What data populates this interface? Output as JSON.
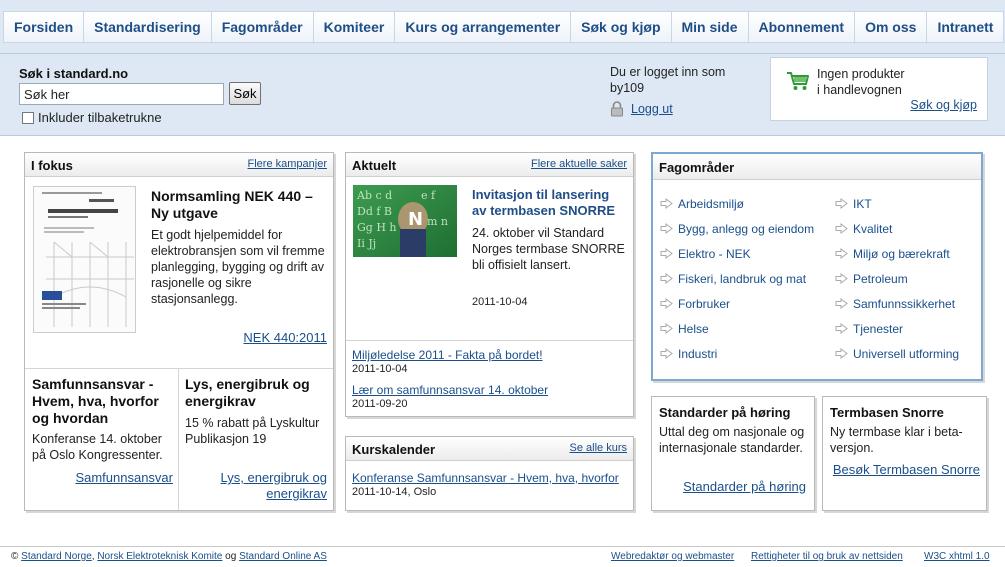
{
  "nav": {
    "items": [
      "Forsiden",
      "Standardisering",
      "Fagområder",
      "Komiteer",
      "Kurs og arrangementer",
      "Søk og kjøp",
      "Min side",
      "Abonnement",
      "Om oss",
      "Intranett"
    ]
  },
  "search": {
    "title": "Søk i standard.no",
    "value": "Søk her",
    "button": "Søk",
    "checkbox_label": "Inkluder tilbaketrukne"
  },
  "login": {
    "line1": "Du er logget inn som",
    "line2": "by109",
    "logout": "Logg ut"
  },
  "cart": {
    "line1": "Ingen produkter",
    "line2": "i handlevognen",
    "link": "Søk og kjøp"
  },
  "fokus": {
    "title": "I fokus",
    "more": "Flere kampanjer",
    "headline": "Normsamling NEK 440 – Ny utgave",
    "desc": "Et godt hjelpemiddel for elektrobransjen som vil fremme planlegging, bygging og drift av rasjonelle og sikre stasjonsanlegg.",
    "link": "NEK 440:2011",
    "sub1": {
      "title": "Samfunnsansvar - Hvem, hva, hvorfor og hvordan",
      "desc": "Konferanse 14. oktober på Oslo Kongressenter.",
      "link": "Samfunnsansvar"
    },
    "sub2": {
      "title": "Lys, energibruk og energikrav",
      "desc": "15 % rabatt på Lyskultur Publikasjon 19",
      "link": "Lys, energibruk og energikrav"
    }
  },
  "aktuelt": {
    "title": "Aktuelt",
    "more": "Flere aktuelle saker",
    "headline": "Invitasjon til lansering av termbasen SNORRE",
    "desc": "24. oktober vil Standard Norges termbase SNORRE bli offisielt lansert.",
    "date": "2011-10-04",
    "news": [
      {
        "title": "Miljøledelse 2011 - Fakta på bordet!",
        "date": "2011-10-04"
      },
      {
        "title": "Lær om samfunnsansvar 14. oktober",
        "date": "2011-09-20"
      }
    ]
  },
  "kurs": {
    "title": "Kurskalender",
    "more": "Se alle kurs",
    "item_title": "Konferanse Samfunnsansvar - Hvem, hva, hvorfor",
    "item_meta": "2011-10-14, Oslo"
  },
  "fag": {
    "title": "Fagområder",
    "col1": [
      "Arbeidsmiljø",
      "Bygg, anlegg og eiendom",
      "Elektro - NEK",
      "Fiskeri, landbruk og mat",
      "Forbruker",
      "Helse",
      "Industri"
    ],
    "col2": [
      "IKT",
      "Kvalitet",
      "Miljø og bærekraft",
      "Petroleum",
      "Samfunnssikkerhet",
      "Tjenester",
      "Universell utforming"
    ]
  },
  "horing": {
    "title": "Standarder på høring",
    "desc": "Uttal deg om nasjonale og internasjonale standarder.",
    "link": "Standarder på høring"
  },
  "termbase": {
    "title": "Termbasen Snorre",
    "desc": "Ny termbase klar i beta-versjon.",
    "link": "Besøk Termbasen Snorre"
  },
  "footer": {
    "copyright": "©",
    "link1": "Standard Norge",
    "sep1": ",",
    "link2": "Norsk Elektroteknisk Komite",
    "og": "og",
    "link3": "Standard Online AS",
    "right1": "Webredaktør og webmaster",
    "right2": "Rettigheter til og bruk av nettsiden",
    "right3": "W3C xhtml 1.0"
  },
  "colors": {
    "nav_bg": "#dde8f4",
    "link": "#1a4f8b",
    "nav_text": "#1f4e86",
    "fag_border": "#7fa7d4"
  }
}
